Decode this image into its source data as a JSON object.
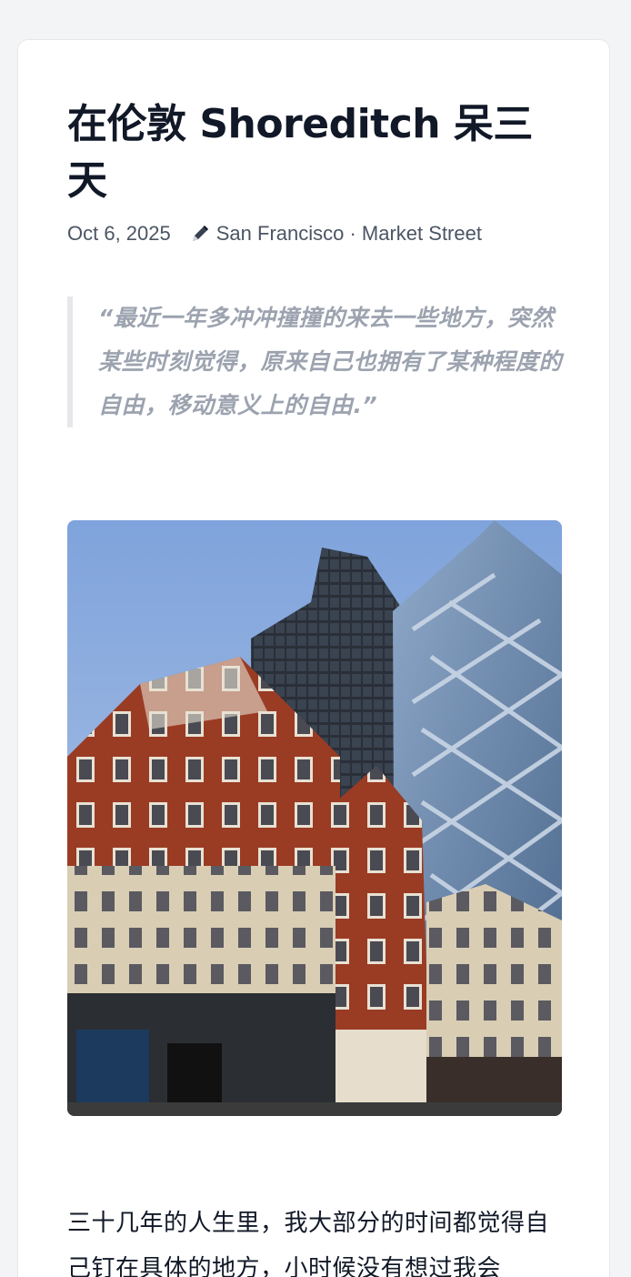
{
  "article": {
    "title": "在伦敦 Shoreditch 呆三天",
    "date": "Oct 6, 2025",
    "location_icon": "pen-icon",
    "location": "San Francisco · Market Street",
    "quote": "“最近一年多冲冲撞撞的来去一些地方，突然某些时刻觉得，原来自己也拥有了某种程度的自由，移动意义上的自由.”",
    "photo_icon": "street-photo-buildings",
    "body": "三十几年的人生里，我大部分的时间都觉得自己钉在具体的地方，小时候没有想过我会"
  },
  "colors": {
    "background": "#f3f4f6",
    "card": "#ffffff",
    "title": "#111827",
    "meta": "#4b5563",
    "quote": "#9ca3af",
    "quote_border": "#e5e7eb"
  }
}
